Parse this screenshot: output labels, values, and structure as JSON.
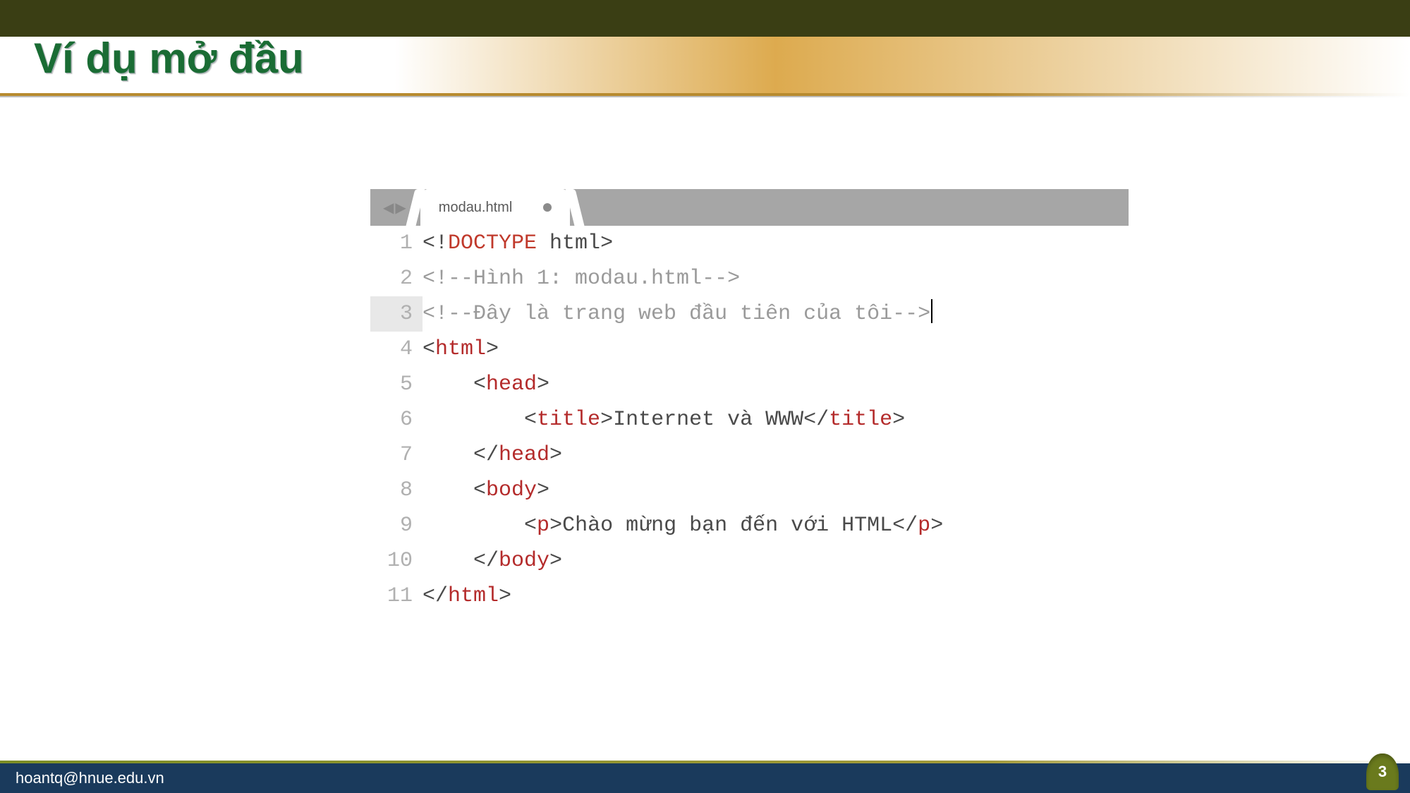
{
  "slide": {
    "title": "Ví dụ mở đầu",
    "page_number": "3"
  },
  "footer": {
    "email": "hoantq@hnue.edu.vn"
  },
  "editor": {
    "tab_name": "modau.html",
    "modified": true,
    "cursor_line": 3,
    "lines": [
      {
        "n": "1",
        "tokens": [
          {
            "t": "<!",
            "c": "c-punct"
          },
          {
            "t": "DOCTYPE",
            "c": "c-doctype"
          },
          {
            "t": " html",
            "c": "c-default"
          },
          {
            "t": ">",
            "c": "c-punct"
          }
        ]
      },
      {
        "n": "2",
        "tokens": [
          {
            "t": "<!--Hình 1: modau.html-->",
            "c": "c-comment"
          }
        ]
      },
      {
        "n": "3",
        "tokens": [
          {
            "t": "<!--Đây là trang web đầu tiên của tôi-->",
            "c": "c-comment"
          }
        ]
      },
      {
        "n": "4",
        "tokens": [
          {
            "t": "<",
            "c": "c-punct"
          },
          {
            "t": "html",
            "c": "c-tag"
          },
          {
            "t": ">",
            "c": "c-punct"
          }
        ]
      },
      {
        "n": "5",
        "tokens": [
          {
            "t": "    ",
            "c": "c-default"
          },
          {
            "t": "<",
            "c": "c-punct"
          },
          {
            "t": "head",
            "c": "c-tag"
          },
          {
            "t": ">",
            "c": "c-punct"
          }
        ]
      },
      {
        "n": "6",
        "tokens": [
          {
            "t": "        ",
            "c": "c-default"
          },
          {
            "t": "<",
            "c": "c-punct"
          },
          {
            "t": "title",
            "c": "c-tag"
          },
          {
            "t": ">",
            "c": "c-punct"
          },
          {
            "t": "Internet và WWW",
            "c": "c-default"
          },
          {
            "t": "</",
            "c": "c-punct"
          },
          {
            "t": "title",
            "c": "c-tag"
          },
          {
            "t": ">",
            "c": "c-punct"
          }
        ]
      },
      {
        "n": "7",
        "tokens": [
          {
            "t": "    ",
            "c": "c-default"
          },
          {
            "t": "</",
            "c": "c-punct"
          },
          {
            "t": "head",
            "c": "c-tag"
          },
          {
            "t": ">",
            "c": "c-punct"
          }
        ]
      },
      {
        "n": "8",
        "tokens": [
          {
            "t": "    ",
            "c": "c-default"
          },
          {
            "t": "<",
            "c": "c-punct"
          },
          {
            "t": "body",
            "c": "c-tag"
          },
          {
            "t": ">",
            "c": "c-punct"
          }
        ]
      },
      {
        "n": "9",
        "tokens": [
          {
            "t": "        ",
            "c": "c-default"
          },
          {
            "t": "<",
            "c": "c-punct"
          },
          {
            "t": "p",
            "c": "c-tag"
          },
          {
            "t": ">",
            "c": "c-punct"
          },
          {
            "t": "Chào mừng bạn đến với HTML",
            "c": "c-default"
          },
          {
            "t": "</",
            "c": "c-punct"
          },
          {
            "t": "p",
            "c": "c-tag"
          },
          {
            "t": ">",
            "c": "c-punct"
          }
        ]
      },
      {
        "n": "10",
        "tokens": [
          {
            "t": "    ",
            "c": "c-default"
          },
          {
            "t": "</",
            "c": "c-punct"
          },
          {
            "t": "body",
            "c": "c-tag"
          },
          {
            "t": ">",
            "c": "c-punct"
          }
        ]
      },
      {
        "n": "11",
        "tokens": [
          {
            "t": "</",
            "c": "c-punct"
          },
          {
            "t": "html",
            "c": "c-tag"
          },
          {
            "t": ">",
            "c": "c-punct"
          }
        ]
      }
    ]
  }
}
